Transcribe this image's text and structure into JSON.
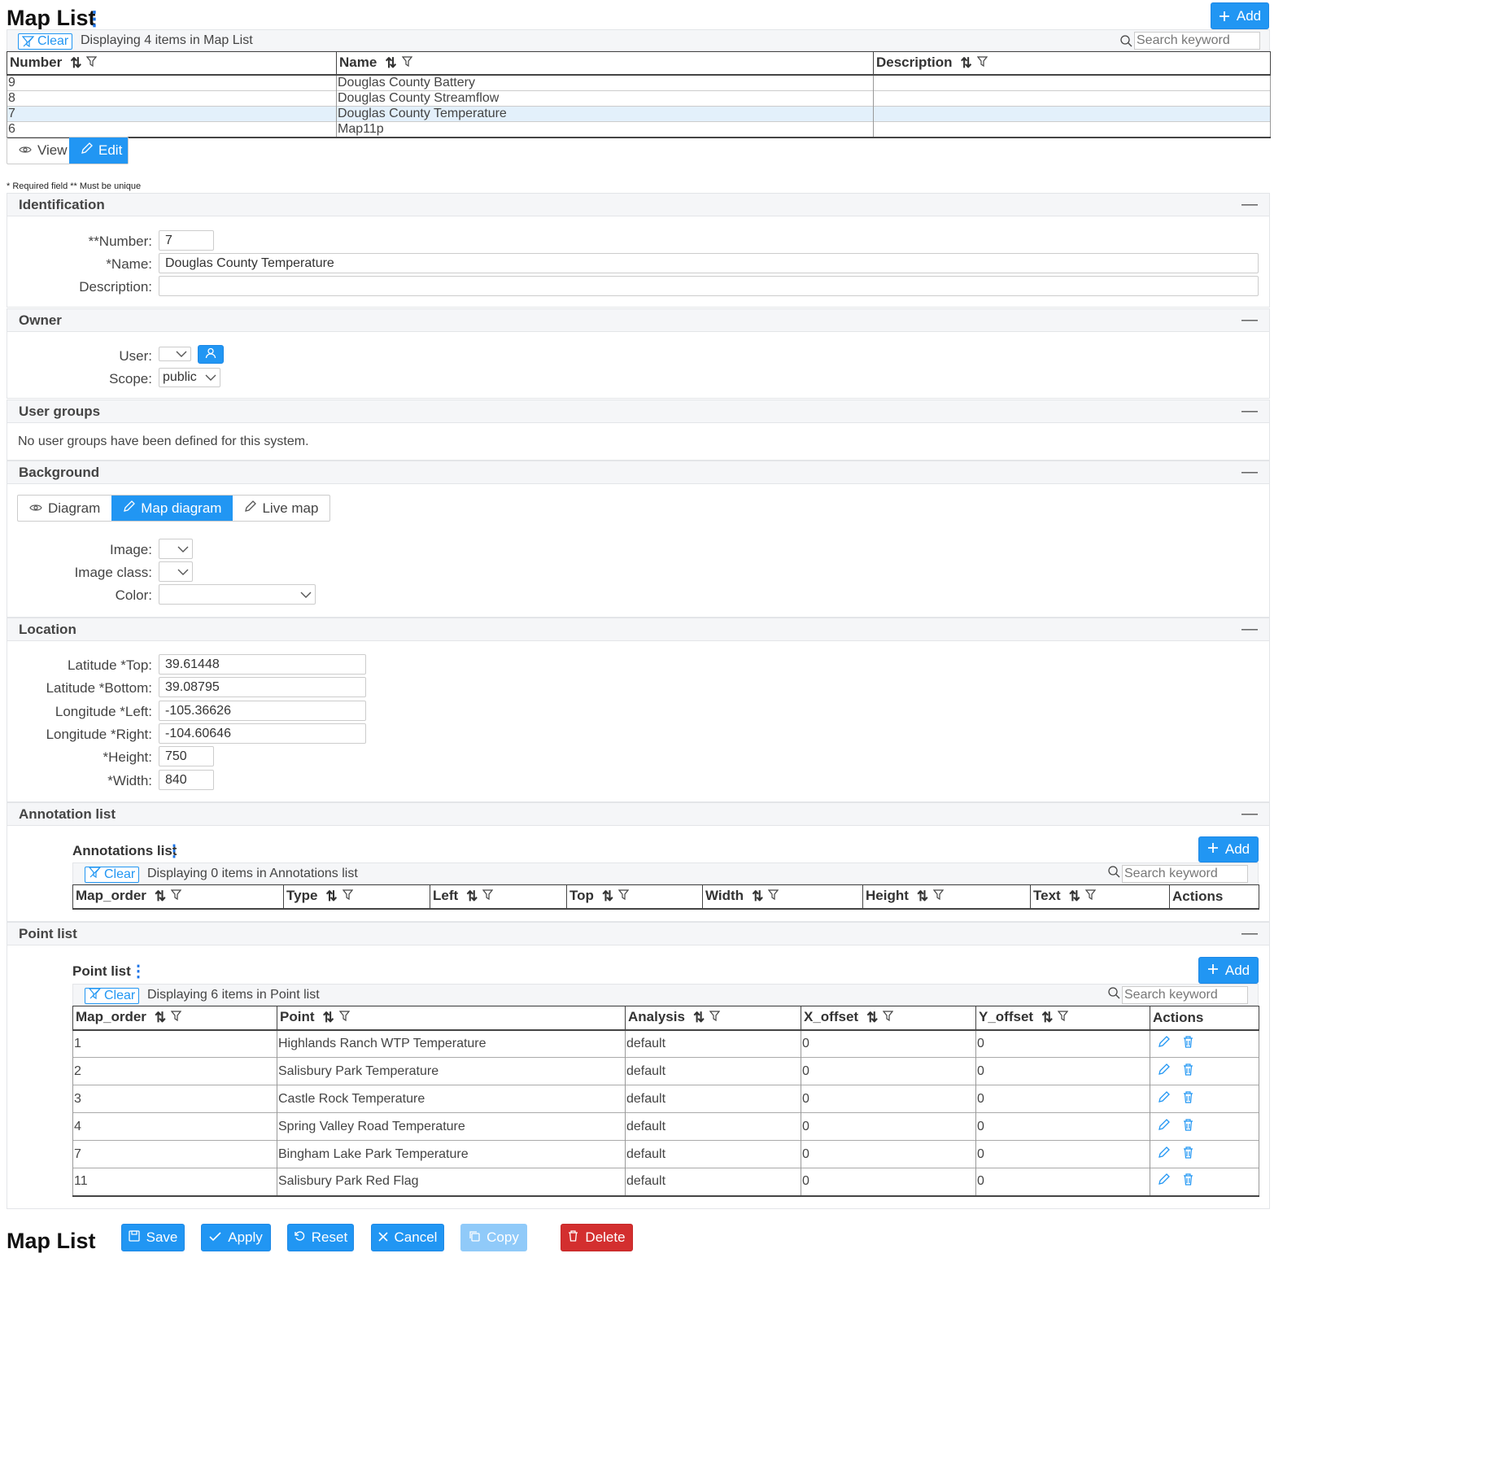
{
  "page": {
    "title": "Map List",
    "footer_title": "Map List",
    "add_label": "Add",
    "required_note": "* Required field ** Must be unique"
  },
  "map_list": {
    "clear_label": "Clear",
    "status": "Displaying 4 items in Map List",
    "search_placeholder": "Search keyword",
    "columns": [
      "Number",
      "Name",
      "Description"
    ],
    "rows": [
      {
        "number": "9",
        "name": "Douglas County Battery",
        "description": "",
        "selected": false
      },
      {
        "number": "8",
        "name": "Douglas County Streamflow",
        "description": "",
        "selected": false
      },
      {
        "number": "7",
        "name": "Douglas County Temperature",
        "description": "",
        "selected": true
      },
      {
        "number": "6",
        "name": "Map11p",
        "description": "",
        "selected": false
      }
    ]
  },
  "mode_tabs": {
    "view": "View",
    "edit": "Edit",
    "active": "edit"
  },
  "identification": {
    "title": "Identification",
    "number_label": "**Number:",
    "number_value": "7",
    "name_label": "*Name:",
    "name_value": "Douglas County Temperature",
    "description_label": "Description:",
    "description_value": ""
  },
  "owner": {
    "title": "Owner",
    "user_label": "User:",
    "user_value": "",
    "scope_label": "Scope:",
    "scope_value": "public"
  },
  "user_groups": {
    "title": "User groups",
    "message": "No user groups have been defined for this system."
  },
  "background": {
    "title": "Background",
    "tabs": [
      "Diagram",
      "Map diagram",
      "Live map"
    ],
    "active_tab": "Map diagram",
    "image_label": "Image:",
    "image_value": "",
    "image_class_label": "Image class:",
    "image_class_value": "",
    "color_label": "Color:",
    "color_value": ""
  },
  "location": {
    "title": "Location",
    "lat_top_label": "Latitude *Top:",
    "lat_top_value": "39.61448",
    "lat_bottom_label": "Latitude *Bottom:",
    "lat_bottom_value": "39.08795",
    "lon_left_label": "Longitude *Left:",
    "lon_left_value": "-105.36626",
    "lon_right_label": "Longitude *Right:",
    "lon_right_value": "-104.60646",
    "height_label": "*Height:",
    "height_value": "750",
    "width_label": "*Width:",
    "width_value": "840"
  },
  "annotation_section": {
    "title": "Annotation list",
    "list_title": "Annotations list",
    "add_label": "Add",
    "clear_label": "Clear",
    "status": "Displaying 0 items in Annotations list",
    "search_placeholder": "Search keyword",
    "columns": [
      "Map_order",
      "Type",
      "Left",
      "Top",
      "Width",
      "Height",
      "Text",
      "Actions"
    ]
  },
  "point_section": {
    "title": "Point list",
    "list_title": "Point list",
    "add_label": "Add",
    "clear_label": "Clear",
    "status": "Displaying 6 items in Point list",
    "search_placeholder": "Search keyword",
    "columns": [
      "Map_order",
      "Point",
      "Analysis",
      "X_offset",
      "Y_offset",
      "Actions"
    ],
    "rows": [
      {
        "map_order": "1",
        "point": "Highlands Ranch WTP Temperature",
        "analysis": "default",
        "x_offset": "0",
        "y_offset": "0"
      },
      {
        "map_order": "2",
        "point": "Salisbury Park Temperature",
        "analysis": "default",
        "x_offset": "0",
        "y_offset": "0"
      },
      {
        "map_order": "3",
        "point": "Castle Rock Temperature",
        "analysis": "default",
        "x_offset": "0",
        "y_offset": "0"
      },
      {
        "map_order": "4",
        "point": "Spring Valley Road Temperature",
        "analysis": "default",
        "x_offset": "0",
        "y_offset": "0"
      },
      {
        "map_order": "7",
        "point": "Bingham Lake Park Temperature",
        "analysis": "default",
        "x_offset": "0",
        "y_offset": "0"
      },
      {
        "map_order": "11",
        "point": "Salisbury Park Red Flag",
        "analysis": "default",
        "x_offset": "0",
        "y_offset": "0"
      }
    ]
  },
  "footer_buttons": {
    "save": "Save",
    "apply": "Apply",
    "reset": "Reset",
    "cancel": "Cancel",
    "copy": "Copy",
    "delete": "Delete"
  },
  "icons": [
    "kebab-menu-icon",
    "plus-icon",
    "filter-clear-icon",
    "search-icon",
    "sort-icon",
    "filter-icon",
    "eye-icon",
    "pencil-icon",
    "user-icon",
    "chevron-down-icon",
    "minus-icon",
    "trash-icon",
    "save-icon",
    "check-icon",
    "reset-icon",
    "close-icon",
    "copy-icon"
  ],
  "colors": {
    "primary": "#2196f3",
    "danger": "#d32f2f",
    "selected_row": "#e3f0fb",
    "disabled": "#90caf9"
  }
}
